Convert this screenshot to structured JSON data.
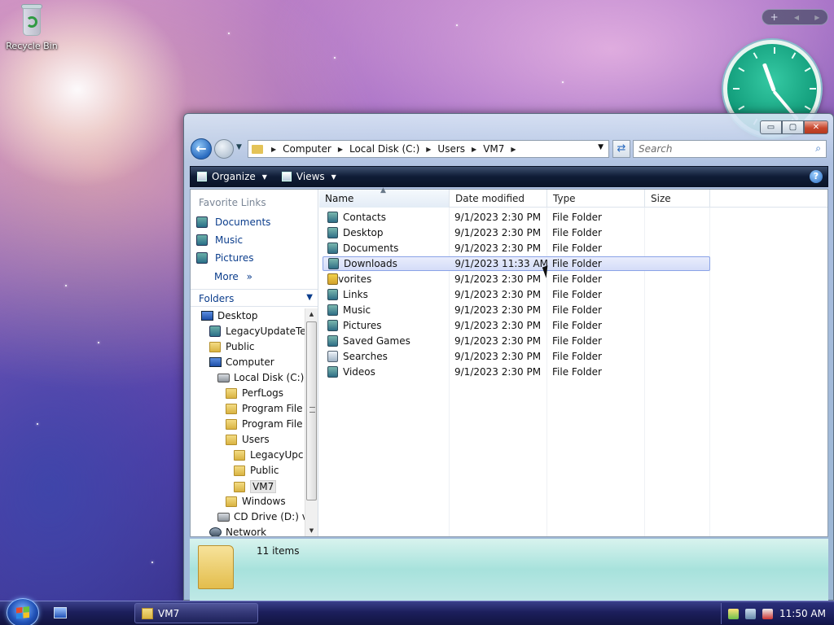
{
  "desktop": {
    "recycle_bin_label": "Recycle Bin"
  },
  "gadgets": {
    "add": "+",
    "prev": "◀",
    "next": "▶"
  },
  "window": {
    "buttons": {
      "minimize": "▭",
      "maximize": "▢",
      "close": "✕"
    },
    "address": {
      "crumbs": [
        "Computer",
        "Local Disk (C:)",
        "Users",
        "VM7"
      ]
    },
    "search_placeholder": "Search",
    "toolbar": {
      "organize": "Organize",
      "views": "Views",
      "help": "?"
    },
    "favorite_links": {
      "title": "Favorite Links",
      "items": [
        "Documents",
        "Music",
        "Pictures"
      ],
      "more": "More"
    },
    "folders_title": "Folders",
    "tree": [
      {
        "label": "Desktop",
        "icon": "desktop-icon"
      },
      {
        "label": "LegacyUpdateTe",
        "icon": "user-folder-icon"
      },
      {
        "label": "Public",
        "icon": "folder-icon"
      },
      {
        "label": "Computer",
        "icon": "computer-icon"
      },
      {
        "label": "Local Disk (C:)",
        "icon": "drive-icon"
      },
      {
        "label": "PerfLogs",
        "icon": "folder-icon"
      },
      {
        "label": "Program File",
        "icon": "folder-icon"
      },
      {
        "label": "Program File",
        "icon": "folder-icon"
      },
      {
        "label": "Users",
        "icon": "folder-icon"
      },
      {
        "label": "LegacyUpc",
        "icon": "folder-icon"
      },
      {
        "label": "Public",
        "icon": "folder-icon"
      },
      {
        "label": "VM7",
        "icon": "folder-icon"
      },
      {
        "label": "Windows",
        "icon": "folder-icon"
      },
      {
        "label": "CD Drive (D:) v",
        "icon": "cd-drive-icon"
      },
      {
        "label": "Network",
        "icon": "network-icon"
      }
    ],
    "columns": [
      "Name",
      "Date modified",
      "Type",
      "Size"
    ],
    "rows": [
      {
        "name": "Contacts",
        "date": "9/1/2023 2:30 PM",
        "type": "File Folder",
        "size": ""
      },
      {
        "name": "Desktop",
        "date": "9/1/2023 2:30 PM",
        "type": "File Folder",
        "size": ""
      },
      {
        "name": "Documents",
        "date": "9/1/2023 2:30 PM",
        "type": "File Folder",
        "size": ""
      },
      {
        "name": "Downloads",
        "date": "9/1/2023 11:33 AM",
        "type": "File Folder",
        "size": ""
      },
      {
        "name": "Favorites",
        "date": "9/1/2023 2:30 PM",
        "type": "File Folder",
        "size": ""
      },
      {
        "name": "Links",
        "date": "9/1/2023 2:30 PM",
        "type": "File Folder",
        "size": ""
      },
      {
        "name": "Music",
        "date": "9/1/2023 2:30 PM",
        "type": "File Folder",
        "size": ""
      },
      {
        "name": "Pictures",
        "date": "9/1/2023 2:30 PM",
        "type": "File Folder",
        "size": ""
      },
      {
        "name": "Saved Games",
        "date": "9/1/2023 2:30 PM",
        "type": "File Folder",
        "size": ""
      },
      {
        "name": "Searches",
        "date": "9/1/2023 2:30 PM",
        "type": "File Folder",
        "size": ""
      },
      {
        "name": "Videos",
        "date": "9/1/2023 2:30 PM",
        "type": "File Folder",
        "size": ""
      }
    ],
    "details": {
      "item_count": "11 items"
    }
  },
  "taskbar": {
    "task_label": "VM7",
    "time": "11:50 AM"
  },
  "colors": {
    "link_blue": "#0b3d8c",
    "selection_highlight": "#d4dcf8",
    "toolbar_dark": "#0f1c36",
    "details_teal": "#a7e2dc"
  }
}
